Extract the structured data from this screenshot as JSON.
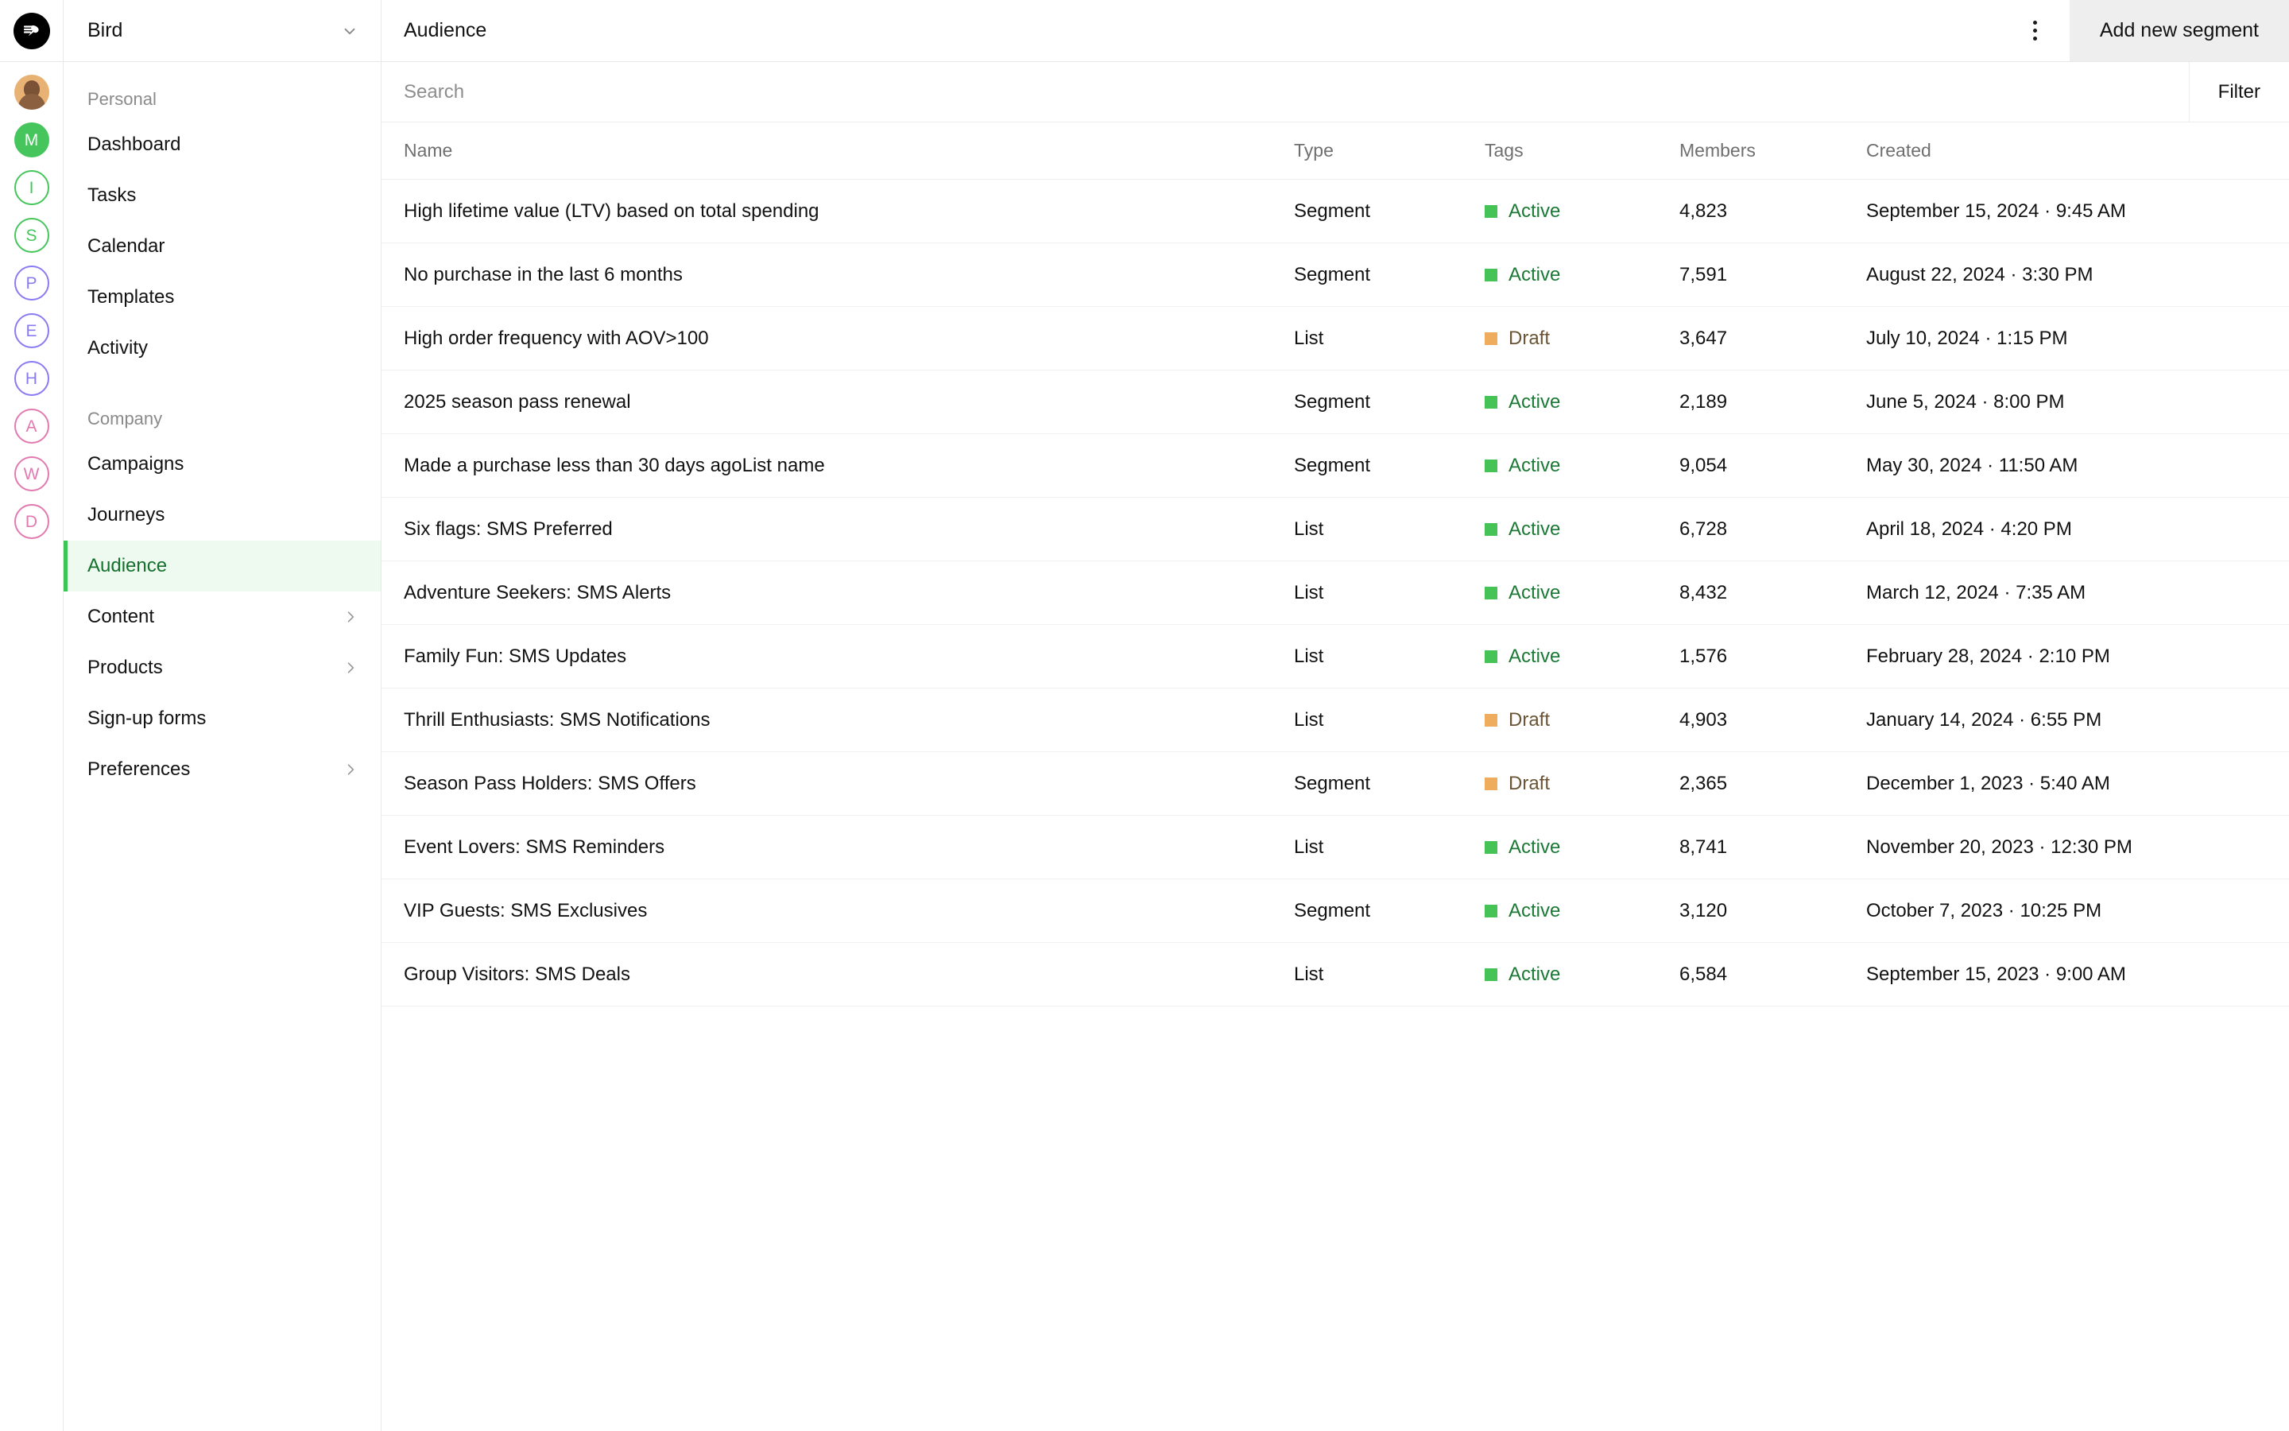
{
  "brand": {
    "logo_icon": "bird-logo-icon"
  },
  "rail": {
    "avatars": [
      {
        "name": "user-photo-avatar",
        "letter": "",
        "style": "photo",
        "color": "#e8b274"
      },
      {
        "name": "avatar-m",
        "letter": "M",
        "style": "filled",
        "color": "#45c55c"
      },
      {
        "name": "avatar-i",
        "letter": "I",
        "style": "outlined",
        "color": "#45c55c"
      },
      {
        "name": "avatar-s",
        "letter": "S",
        "style": "outlined",
        "color": "#45c55c"
      },
      {
        "name": "avatar-p",
        "letter": "P",
        "style": "outlined",
        "color": "#8a7bf0"
      },
      {
        "name": "avatar-e",
        "letter": "E",
        "style": "outlined",
        "color": "#8a7bf0"
      },
      {
        "name": "avatar-h",
        "letter": "H",
        "style": "outlined",
        "color": "#8a7bf0"
      },
      {
        "name": "avatar-a",
        "letter": "A",
        "style": "outlined",
        "color": "#e07ab0"
      },
      {
        "name": "avatar-w",
        "letter": "W",
        "style": "outlined",
        "color": "#e07ab0"
      },
      {
        "name": "avatar-d",
        "letter": "D",
        "style": "outlined",
        "color": "#e07ab0"
      }
    ]
  },
  "sidebar": {
    "workspace": "Bird",
    "workspace_chevron_icon": "chevron-down-icon",
    "sections": [
      {
        "label": "Personal",
        "items": [
          {
            "label": "Dashboard",
            "expandable": false,
            "active": false
          },
          {
            "label": "Tasks",
            "expandable": false,
            "active": false
          },
          {
            "label": "Calendar",
            "expandable": false,
            "active": false
          },
          {
            "label": "Templates",
            "expandable": false,
            "active": false
          },
          {
            "label": "Activity",
            "expandable": false,
            "active": false
          }
        ]
      },
      {
        "label": "Company",
        "items": [
          {
            "label": "Campaigns",
            "expandable": false,
            "active": false
          },
          {
            "label": "Journeys",
            "expandable": false,
            "active": false
          },
          {
            "label": "Audience",
            "expandable": false,
            "active": true
          },
          {
            "label": "Content",
            "expandable": true,
            "active": false
          },
          {
            "label": "Products",
            "expandable": true,
            "active": false
          },
          {
            "label": "Sign-up forms",
            "expandable": false,
            "active": false
          },
          {
            "label": "Preferences",
            "expandable": true,
            "active": false
          }
        ]
      }
    ]
  },
  "topbar": {
    "title": "Audience",
    "kebab_icon": "more-vertical-icon",
    "add_segment_label": "Add new segment"
  },
  "search": {
    "placeholder": "Search",
    "value": "",
    "filter_label": "Filter"
  },
  "table": {
    "columns": [
      "Name",
      "Type",
      "Tags",
      "Members",
      "Created"
    ],
    "rows": [
      {
        "name": "High lifetime value (LTV) based on total spending",
        "type": "Segment",
        "tag": "Active",
        "members": "4,823",
        "created": "September 15, 2024 · 9:45 AM"
      },
      {
        "name": "No purchase in the last 6 months",
        "type": "Segment",
        "tag": "Active",
        "members": "7,591",
        "created": "August 22, 2024 · 3:30 PM"
      },
      {
        "name": "High order frequency with AOV>100",
        "type": "List",
        "tag": "Draft",
        "members": "3,647",
        "created": "July 10, 2024 · 1:15 PM"
      },
      {
        "name": "2025 season pass renewal",
        "type": "Segment",
        "tag": "Active",
        "members": "2,189",
        "created": "June 5, 2024 · 8:00 PM"
      },
      {
        "name": "Made a purchase less than 30 days agoList name",
        "type": "Segment",
        "tag": "Active",
        "members": "9,054",
        "created": "May 30, 2024 · 11:50 AM"
      },
      {
        "name": "Six flags: SMS Preferred",
        "type": "List",
        "tag": "Active",
        "members": "6,728",
        "created": "April 18, 2024 · 4:20 PM"
      },
      {
        "name": "Adventure Seekers: SMS Alerts",
        "type": "List",
        "tag": "Active",
        "members": "8,432",
        "created": "March 12, 2024 · 7:35 AM"
      },
      {
        "name": "Family Fun: SMS Updates",
        "type": "List",
        "tag": "Active",
        "members": "1,576",
        "created": "February 28, 2024 · 2:10 PM"
      },
      {
        "name": "Thrill Enthusiasts: SMS Notifications",
        "type": "List",
        "tag": "Draft",
        "members": "4,903",
        "created": "January 14, 2024 · 6:55 PM"
      },
      {
        "name": "Season Pass Holders: SMS Offers",
        "type": "Segment",
        "tag": "Draft",
        "members": "2,365",
        "created": "December 1, 2023 · 5:40 AM"
      },
      {
        "name": "Event Lovers: SMS Reminders",
        "type": "List",
        "tag": "Active",
        "members": "8,741",
        "created": "November 20, 2023 · 12:30 PM"
      },
      {
        "name": "VIP Guests: SMS Exclusives",
        "type": "Segment",
        "tag": "Active",
        "members": "3,120",
        "created": "October 7, 2023 · 10:25 PM"
      },
      {
        "name": "Group Visitors: SMS Deals",
        "type": "List",
        "tag": "Active",
        "members": "6,584",
        "created": "September 15, 2023 · 9:00 AM"
      }
    ]
  },
  "colors": {
    "accent_green": "#46c357",
    "active_text": "#1a7a35",
    "draft_swatch": "#eeac5d",
    "active_nav_bg": "#eefaf0",
    "button_bg": "#eeeeee"
  }
}
